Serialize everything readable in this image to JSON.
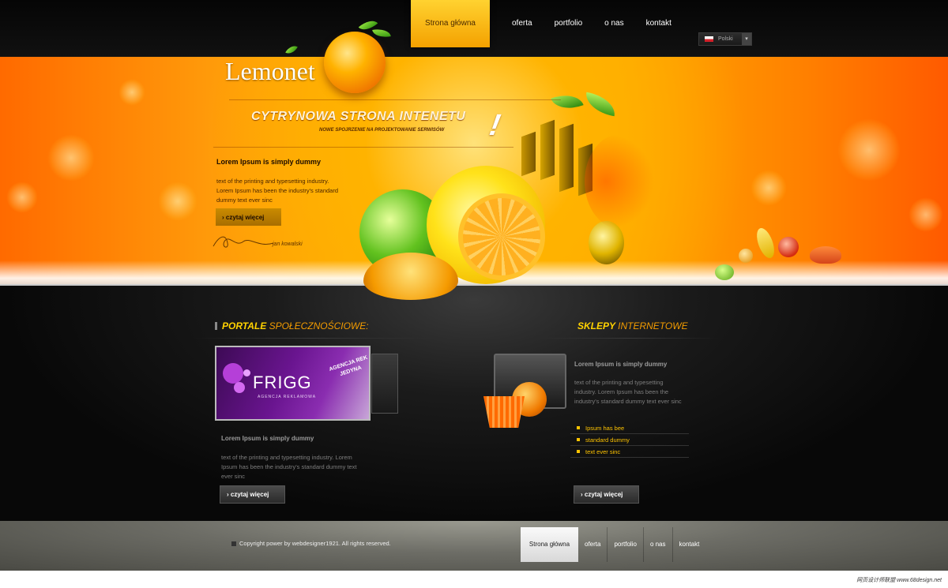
{
  "brand": {
    "name": "Lemonet"
  },
  "nav": {
    "items": [
      "Strona główna",
      "oferta",
      "portfolio",
      "o nas",
      "kontakt"
    ],
    "language": "Polski"
  },
  "hero": {
    "title": "CYTRYNOWA STRONA INTENETU",
    "subtitle": "NOWE SPOJRZENIE NA PROJEKTOWANIE SERWISÓW",
    "exclaim": "!",
    "intro_title": "Lorem Ipsum is simply dummy",
    "intro_text": "text of the printing and typesetting industry. Lorem Ipsum has been the industry's standard dummy text ever sinc",
    "button": "› czytaj więcej",
    "signature_name": "jan kowalski"
  },
  "left_section": {
    "title_highlight": "PORTALE",
    "title_rest": "SPOŁECZNOŚCIOWE:",
    "banner_logo": "FRIGG",
    "banner_tagline": "AGENCJA REKLAMOWA",
    "banner_badge": "AGENCJA REK JEDYNA",
    "card_title": "Lorem Ipsum is simply dummy",
    "card_text": "text of the printing and typesetting industry. Lorem Ipsum has been the industry's standard dummy text ever sinc",
    "button": "› czytaj więcej"
  },
  "right_section": {
    "title_highlight": "SKLEPY",
    "title_rest": "INTERNETOWE",
    "card_title": "Lorem Ipsum is simply dummy",
    "card_text": "text of the printing and typesetting industry. Lorem Ipsum has been the industry's standard dummy text ever sinc",
    "bullets": [
      "Ipsum has bee",
      "standard dummy",
      "text ever sinc"
    ],
    "button": "› czytaj więcej"
  },
  "footer": {
    "copyright": "Copyright power by webdesigner1921. All rights reserved.",
    "nav": [
      "Strona główna",
      "oferta",
      "portfolio",
      "o nas",
      "kontakt"
    ]
  },
  "watermark": "网页设计师联盟 www.68design.net",
  "colors": {
    "accent": "#ffb300",
    "highlight": "#ffd200",
    "dark": "#0a0a0a"
  }
}
